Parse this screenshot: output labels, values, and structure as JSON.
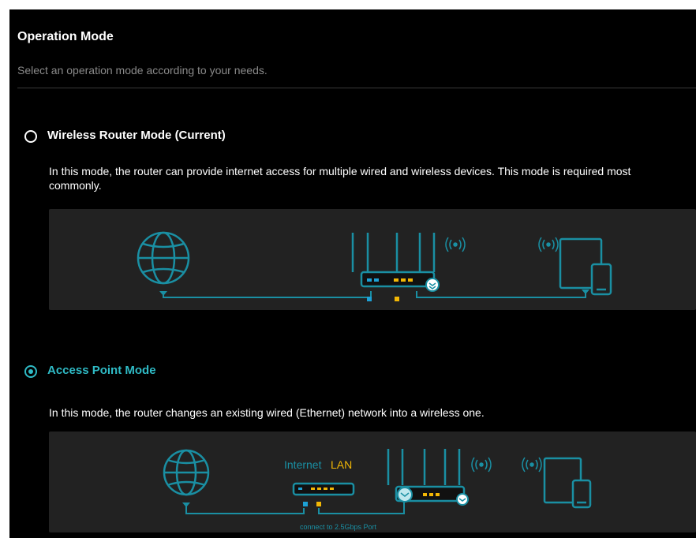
{
  "header": {
    "title": "Operation Mode",
    "subtitle": "Select an operation mode according to your needs."
  },
  "modes": [
    {
      "label": "Wireless Router Mode (Current)",
      "selected": false,
      "description": "In this mode, the router can provide internet access for multiple wired and wireless devices. This mode is required most commonly."
    },
    {
      "label": "Access Point Mode",
      "selected": true,
      "description": "In this mode, the router changes an existing wired (Ethernet) network into a wireless one."
    }
  ],
  "ap_diagram": {
    "internet_label": "Internet",
    "lan_label": "LAN",
    "port_note": "connect to 2.5Gbps Port"
  },
  "colors": {
    "accent": "#2fbbc6",
    "yellow": "#f2b705",
    "blue": "#1da1d6",
    "diagram_bg": "#222222"
  }
}
